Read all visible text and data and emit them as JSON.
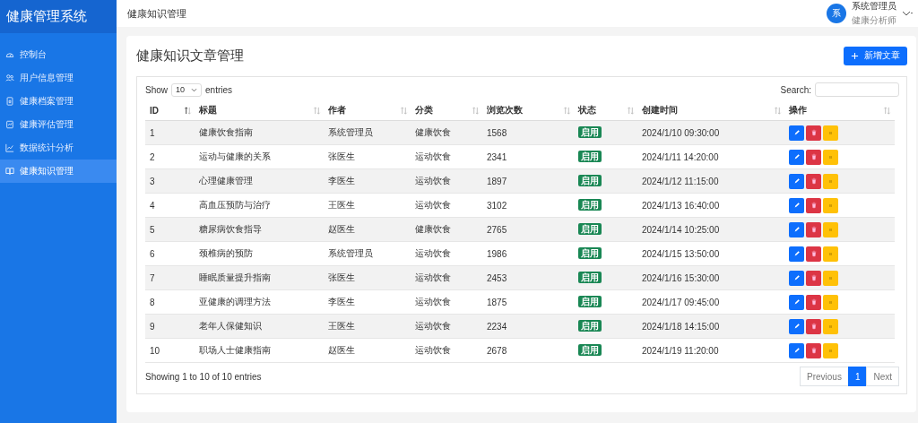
{
  "sidebar": {
    "brand": "健康管理系统",
    "items": [
      {
        "label": "控制台",
        "selected": false
      },
      {
        "label": "用户信息管理",
        "selected": false
      },
      {
        "label": "健康档案管理",
        "selected": false
      },
      {
        "label": "健康评估管理",
        "selected": false
      },
      {
        "label": "数据统计分析",
        "selected": false
      },
      {
        "label": "健康知识管理",
        "selected": true
      }
    ]
  },
  "header": {
    "title": "健康知识管理",
    "user": {
      "avatar": "系",
      "name": "系统管理员",
      "role": "健康分析师"
    }
  },
  "card": {
    "title": "健康知识文章管理",
    "add_button": "新增文章"
  },
  "table_controls": {
    "show_label": "Show",
    "page_size": "10",
    "entries_label": "entries",
    "search_label": "Search:"
  },
  "table": {
    "columns": [
      {
        "label": "ID",
        "sorted": true
      },
      {
        "label": "标题",
        "sorted": false
      },
      {
        "label": "作者",
        "sorted": false
      },
      {
        "label": "分类",
        "sorted": false
      },
      {
        "label": "浏览次数",
        "sorted": false
      },
      {
        "label": "状态",
        "sorted": false
      },
      {
        "label": "创建时间",
        "sorted": false
      },
      {
        "label": "操作",
        "sorted": false
      }
    ],
    "rows": [
      {
        "id": "1",
        "title": "健康饮食指南",
        "author": "系统管理员",
        "category": "健康饮食",
        "views": "1568",
        "status": "启用",
        "created": "2024/1/10 09:30:00"
      },
      {
        "id": "2",
        "title": "运动与健康的关系",
        "author": "张医生",
        "category": "运动饮食",
        "views": "2341",
        "status": "启用",
        "created": "2024/1/11 14:20:00"
      },
      {
        "id": "3",
        "title": "心理健康管理",
        "author": "李医生",
        "category": "运动饮食",
        "views": "1897",
        "status": "启用",
        "created": "2024/1/12 11:15:00"
      },
      {
        "id": "4",
        "title": "高血压预防与治疗",
        "author": "王医生",
        "category": "运动饮食",
        "views": "3102",
        "status": "启用",
        "created": "2024/1/13 16:40:00"
      },
      {
        "id": "5",
        "title": "糖尿病饮食指导",
        "author": "赵医生",
        "category": "健康饮食",
        "views": "2765",
        "status": "启用",
        "created": "2024/1/14 10:25:00"
      },
      {
        "id": "6",
        "title": "颈椎病的预防",
        "author": "系统管理员",
        "category": "运动饮食",
        "views": "1986",
        "status": "启用",
        "created": "2024/1/15 13:50:00"
      },
      {
        "id": "7",
        "title": "睡眠质量提升指南",
        "author": "张医生",
        "category": "运动饮食",
        "views": "2453",
        "status": "启用",
        "created": "2024/1/16 15:30:00"
      },
      {
        "id": "8",
        "title": "亚健康的调理方法",
        "author": "李医生",
        "category": "运动饮食",
        "views": "1875",
        "status": "启用",
        "created": "2024/1/17 09:45:00"
      },
      {
        "id": "9",
        "title": "老年人保健知识",
        "author": "王医生",
        "category": "运动饮食",
        "views": "2234",
        "status": "启用",
        "created": "2024/1/18 14:15:00"
      },
      {
        "id": "10",
        "title": "职场人士健康指南",
        "author": "赵医生",
        "category": "运动饮食",
        "views": "2678",
        "status": "启用",
        "created": "2024/1/19 11:20:00"
      }
    ]
  },
  "footer": {
    "info": "Showing 1 to 10 of 10 entries",
    "pagination": [
      {
        "label": "Previous",
        "selected": false
      },
      {
        "label": "1",
        "selected": true
      },
      {
        "label": "Next",
        "selected": false
      }
    ]
  }
}
